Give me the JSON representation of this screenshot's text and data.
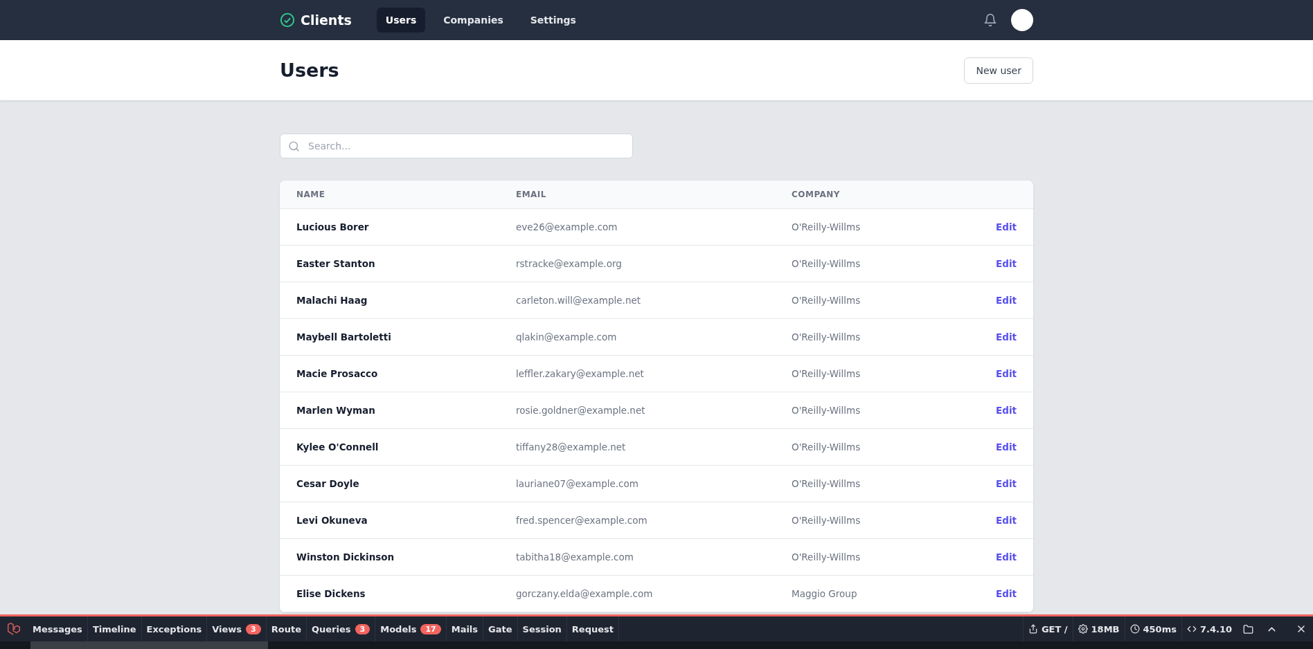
{
  "nav": {
    "brand": "Clients",
    "links": [
      {
        "label": "Users",
        "selected": true
      },
      {
        "label": "Companies",
        "selected": false
      },
      {
        "label": "Settings",
        "selected": false
      }
    ]
  },
  "header": {
    "title": "Users",
    "button": "New user"
  },
  "search": {
    "placeholder": "Search..."
  },
  "table": {
    "columns": [
      "NAME",
      "EMAIL",
      "COMPANY"
    ],
    "rows": [
      {
        "name": "Lucious Borer",
        "email": "eve26@example.com",
        "company": "O'Reilly-Willms",
        "action": "Edit"
      },
      {
        "name": "Easter Stanton",
        "email": "rstracke@example.org",
        "company": "O'Reilly-Willms",
        "action": "Edit"
      },
      {
        "name": "Malachi Haag",
        "email": "carleton.will@example.net",
        "company": "O'Reilly-Willms",
        "action": "Edit"
      },
      {
        "name": "Maybell Bartoletti",
        "email": "qlakin@example.com",
        "company": "O'Reilly-Willms",
        "action": "Edit"
      },
      {
        "name": "Macie Prosacco",
        "email": "leffler.zakary@example.net",
        "company": "O'Reilly-Willms",
        "action": "Edit"
      },
      {
        "name": "Marlen Wyman",
        "email": "rosie.goldner@example.net",
        "company": "O'Reilly-Willms",
        "action": "Edit"
      },
      {
        "name": "Kylee O'Connell",
        "email": "tiffany28@example.net",
        "company": "O'Reilly-Willms",
        "action": "Edit"
      },
      {
        "name": "Cesar Doyle",
        "email": "lauriane07@example.com",
        "company": "O'Reilly-Willms",
        "action": "Edit"
      },
      {
        "name": "Levi Okuneva",
        "email": "fred.spencer@example.com",
        "company": "O'Reilly-Willms",
        "action": "Edit"
      },
      {
        "name": "Winston Dickinson",
        "email": "tabitha18@example.com",
        "company": "O'Reilly-Willms",
        "action": "Edit"
      },
      {
        "name": "Elise Dickens",
        "email": "gorczany.elda@example.com",
        "company": "Maggio Group",
        "action": "Edit"
      }
    ]
  },
  "debugbar": {
    "tabs": [
      {
        "label": "Messages"
      },
      {
        "label": "Timeline"
      },
      {
        "label": "Exceptions"
      },
      {
        "label": "Views",
        "badge": "3"
      },
      {
        "label": "Route"
      },
      {
        "label": "Queries",
        "badge": "3"
      },
      {
        "label": "Models",
        "badge": "17"
      },
      {
        "label": "Mails"
      },
      {
        "label": "Gate"
      },
      {
        "label": "Session"
      },
      {
        "label": "Request"
      }
    ],
    "stats": [
      {
        "kind": "request",
        "text": "GET /"
      },
      {
        "kind": "memory",
        "text": "18MB"
      },
      {
        "kind": "time",
        "text": "450ms"
      },
      {
        "kind": "version",
        "text": "7.4.10"
      }
    ]
  }
}
